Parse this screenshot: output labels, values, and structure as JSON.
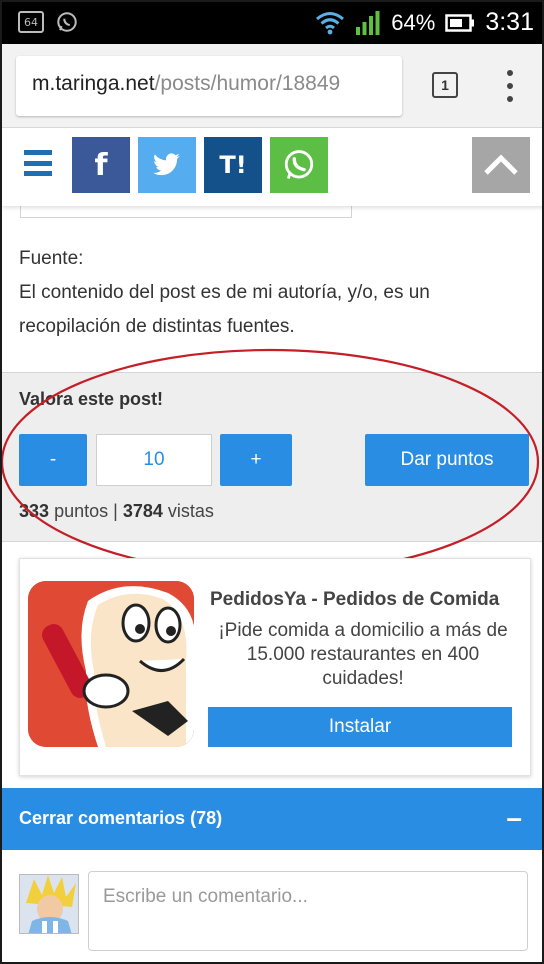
{
  "status_bar": {
    "left_icons": [
      "storage-64-icon",
      "whatsapp-notification-icon"
    ],
    "storage_label": "64",
    "battery": "64%",
    "time": "3:31"
  },
  "browser": {
    "url_host": "m.taringa.net",
    "url_path": "/posts/humor/18849",
    "tab_count": "1"
  },
  "share_bar": {
    "facebook_glyph": "f",
    "taringa_glyph": "T!",
    "icons": [
      "hamburger-menu-icon",
      "facebook-icon",
      "twitter-icon",
      "taringa-icon",
      "whatsapp-icon",
      "chevron-up-icon"
    ],
    "colors": {
      "facebook": "#3b5998",
      "twitter": "#55acee",
      "taringa": "#14508a",
      "whatsapp": "#5cbe44",
      "scroll_top": "#a6a6a6"
    }
  },
  "post": {
    "source_label": "Fuente:",
    "source_text": "El contenido del post es de mi autoría, y/o, es un recopilación de distintas fuentes."
  },
  "rating": {
    "title": "Valora este post!",
    "minus_label": "-",
    "points_value": "10",
    "plus_label": "+",
    "give_points_label": "Dar puntos",
    "points_count": "333",
    "points_label": "puntos",
    "separator": "|",
    "views_count": "3784",
    "views_label": "vistas",
    "accent_color": "#2a8de4"
  },
  "ad": {
    "title": "PedidosYa - Pedidos de Comida",
    "description": "¡Pide comida a domicilio a más de 15.000 restaurantes en 400 cuidades!",
    "install_label": "Instalar"
  },
  "comments": {
    "header": "Cerrar comentarios (78)",
    "collapse_glyph": "–",
    "input_placeholder": "Escribe un comentario..."
  }
}
